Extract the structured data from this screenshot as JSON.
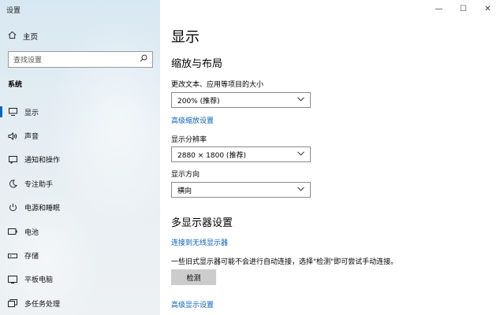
{
  "window": {
    "title": "设置"
  },
  "sidebar": {
    "home_label": "主页",
    "search_placeholder": "查找设置",
    "section": "系统",
    "items": [
      {
        "label": "显示",
        "icon": "monitor-icon",
        "active": true
      },
      {
        "label": "声音",
        "icon": "speaker-icon"
      },
      {
        "label": "通知和操作",
        "icon": "notification-icon"
      },
      {
        "label": "专注助手",
        "icon": "moon-icon"
      },
      {
        "label": "电源和睡眠",
        "icon": "power-icon"
      },
      {
        "label": "电池",
        "icon": "battery-icon"
      },
      {
        "label": "存储",
        "icon": "storage-icon"
      },
      {
        "label": "平板电脑",
        "icon": "tablet-icon"
      },
      {
        "label": "多任务处理",
        "icon": "multitasking-icon"
      }
    ]
  },
  "main": {
    "title": "显示",
    "scale_heading": "缩放与布局",
    "scale_label": "更改文本、应用等项目的大小",
    "scale_value": "200% (推荐)",
    "advanced_scaling_link": "高级缩放设置",
    "resolution_label": "显示分辨率",
    "resolution_value": "2880 × 1800 (推荐)",
    "orientation_label": "显示方向",
    "orientation_value": "横向",
    "multi_heading": "多显示器设置",
    "wireless_link": "连接到无线显示器",
    "detect_note": "一些旧式显示器可能不会进行自动连接，选择\"检测\"即可尝试手动连接。",
    "detect_button": "检测",
    "advanced_display_link": "高级显示设置"
  },
  "colors": {
    "accent": "#0067c0",
    "link": "#0a5fb4"
  }
}
